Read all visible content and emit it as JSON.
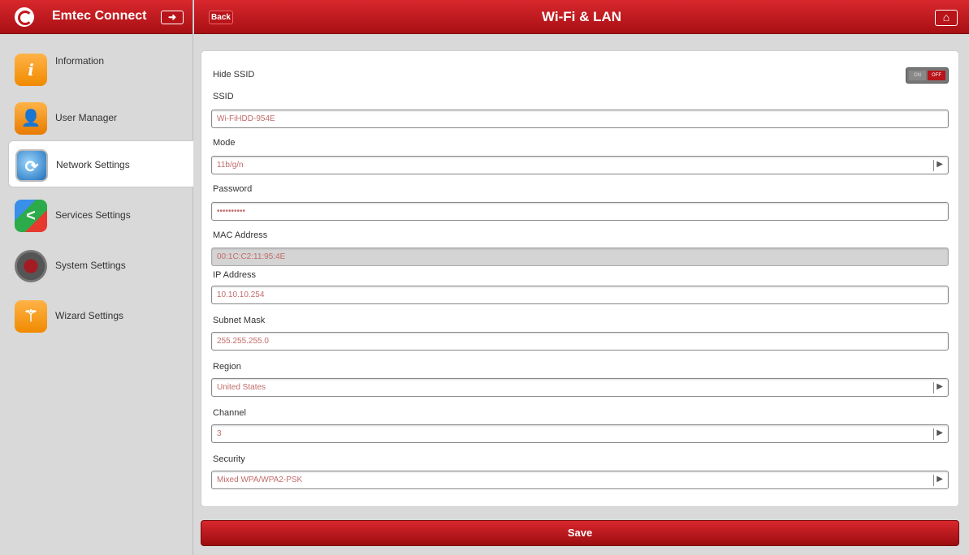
{
  "app": {
    "title": "Emtec Connect"
  },
  "header": {
    "back_label": "Back",
    "title": "Wi-Fi & LAN",
    "home_icon": "home-icon",
    "logout_icon": "logout-icon"
  },
  "sidebar": {
    "items": [
      {
        "label": "Information",
        "icon": "information-icon"
      },
      {
        "label": "User Manager",
        "icon": "user-manager-icon"
      },
      {
        "label": "Network Settings",
        "icon": "network-icon",
        "active": true
      },
      {
        "label": "Services Settings",
        "icon": "share-icon"
      },
      {
        "label": "System Settings",
        "icon": "gear-icon"
      },
      {
        "label": "Wizard Settings",
        "icon": "wand-icon"
      }
    ]
  },
  "form": {
    "hide_ssid": {
      "label": "Hide SSID",
      "on_label": "ON",
      "off_label": "OFF",
      "value": "OFF"
    },
    "ssid": {
      "label": "SSID",
      "value": "Wi-FiHDD-954E"
    },
    "mode": {
      "label": "Mode",
      "value": "11b/g/n"
    },
    "password": {
      "label": "Password",
      "value": "••••••••••"
    },
    "mac": {
      "label": "MAC Address",
      "value": "00:1C:C2:11:95:4E"
    },
    "ip": {
      "label": "IP Address",
      "value": "10.10.10.254"
    },
    "subnet": {
      "label": "Subnet Mask",
      "value": "255.255.255.0"
    },
    "region": {
      "label": "Region",
      "value": "United States"
    },
    "channel": {
      "label": "Channel",
      "value": "3"
    },
    "security": {
      "label": "Security",
      "value": "Mixed WPA/WPA2-PSK"
    }
  },
  "actions": {
    "save_label": "Save"
  },
  "colors": {
    "brand_red": "#c5161c",
    "value_text": "#c26b6b"
  }
}
